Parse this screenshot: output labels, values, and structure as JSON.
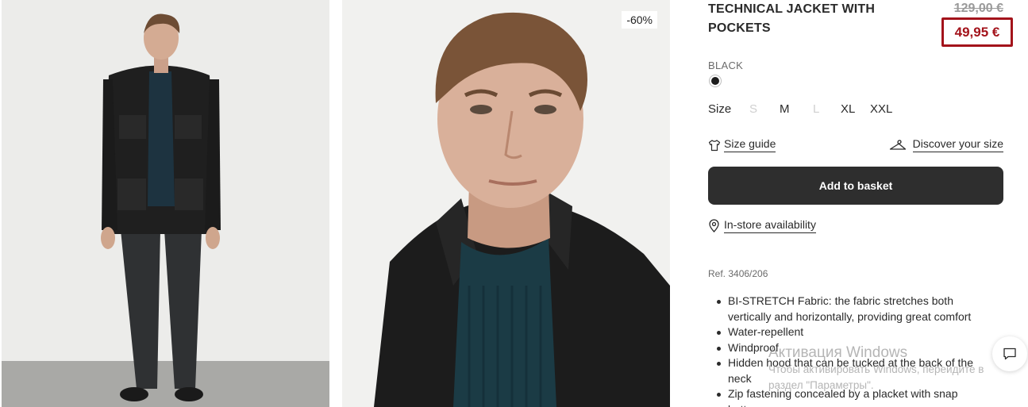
{
  "product": {
    "title": "TECHNICAL JACKET WITH POCKETS",
    "price_old": "129,00 €",
    "price_new": "49,95 €",
    "discount_badge": "-60%",
    "color_name": "BLACK",
    "swatch_color": "#1c1c1c",
    "price_accent_color": "#a3131b",
    "ref": "Ref. 3406/206"
  },
  "sizes": {
    "label": "Size",
    "options": [
      {
        "label": "S",
        "available": false
      },
      {
        "label": "M",
        "available": true
      },
      {
        "label": "L",
        "available": false
      },
      {
        "label": "XL",
        "available": true
      },
      {
        "label": "XXL",
        "available": true
      }
    ]
  },
  "links": {
    "size_guide": "Size guide",
    "discover_size": "Discover your size",
    "in_store": "In-store availability"
  },
  "actions": {
    "add_to_basket": "Add to basket"
  },
  "features": [
    "BI-STRETCH Fabric: the fabric stretches both vertically and horizontally, providing great comfort",
    "Water-repellent",
    "Windproof",
    "Hidden hood that can be tucked at the back of the neck",
    "Zip fastening concealed by a placket with snap buttons"
  ],
  "windows_watermark": {
    "title": "Активация Windows",
    "subtitle": "Чтобы активировать Windows, перейдите в раздел \"Параметры\"."
  },
  "icons": {
    "shirt": "shirt-icon",
    "hanger": "hanger-icon",
    "location": "location-pin-icon",
    "chat": "chat-icon"
  }
}
